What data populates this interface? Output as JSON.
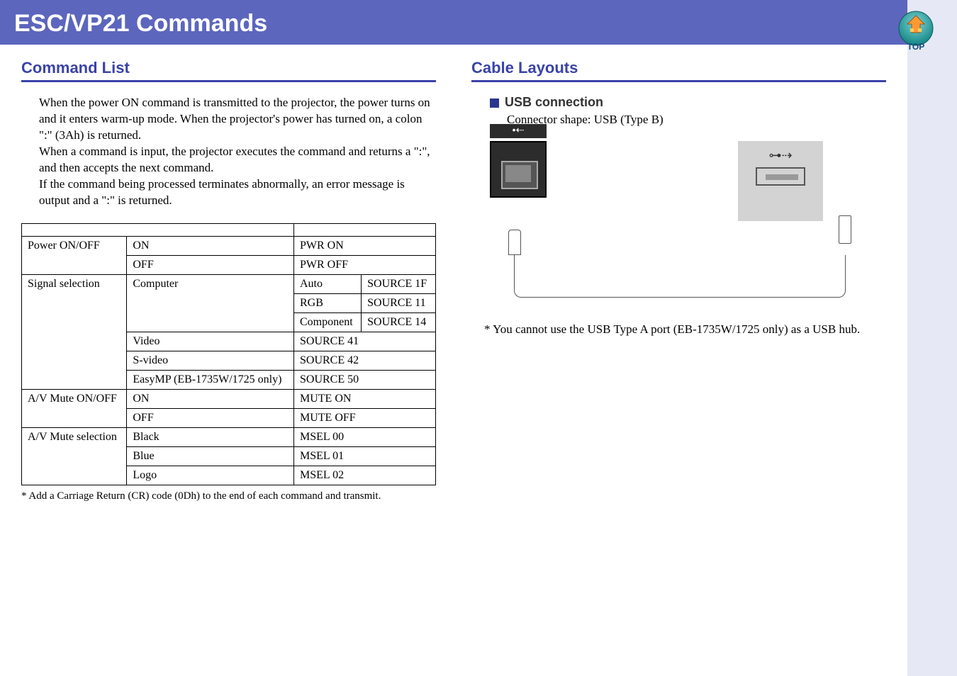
{
  "header": {
    "title": "ESC/VP21 Commands"
  },
  "left": {
    "title": "Command List",
    "intro": "When the power ON command is transmitted to the projector, the power turns on and it enters warm-up mode. When the projector's power has turned on, a colon \":\" (3Ah) is returned.\nWhen a command is input, the projector executes the command and returns a \":\", and then accepts the next command.\nIf the command being processed terminates abnormally, an error message is output and a \":\" is returned.",
    "table": {
      "rows": [
        {
          "item": "Power ON/OFF",
          "sub": "ON",
          "cmd": "PWR ON"
        },
        {
          "item": "",
          "sub": "OFF",
          "cmd": "PWR OFF"
        },
        {
          "item": "Signal selection",
          "sub": "Computer",
          "mode": "Auto",
          "cmd": "SOURCE 1F"
        },
        {
          "item": "",
          "sub": "",
          "mode": "RGB",
          "cmd": "SOURCE 11"
        },
        {
          "item": "",
          "sub": "",
          "mode": "Component",
          "cmd": "SOURCE 14"
        },
        {
          "item": "",
          "sub": "Video",
          "cmd": "SOURCE 41"
        },
        {
          "item": "",
          "sub": "S-video",
          "cmd": "SOURCE 42"
        },
        {
          "item": "",
          "sub": "EasyMP (EB-1735W/1725 only)",
          "cmd": "SOURCE 50"
        },
        {
          "item": "A/V Mute ON/OFF",
          "sub": "ON",
          "cmd": "MUTE ON"
        },
        {
          "item": "",
          "sub": "OFF",
          "cmd": "MUTE OFF"
        },
        {
          "item": "A/V Mute selection",
          "sub": "Black",
          "cmd": "MSEL 00"
        },
        {
          "item": "",
          "sub": "Blue",
          "cmd": "MSEL 01"
        },
        {
          "item": "",
          "sub": "Logo",
          "cmd": "MSEL 02"
        }
      ]
    },
    "footnote": "*  Add a Carriage Return (CR) code (0Dh) to the end of each command and transmit."
  },
  "right": {
    "title": "Cable Layouts",
    "subheading": "USB connection",
    "connector_desc": "Connector shape: USB (Type B)",
    "note": "* You cannot use the USB Type A port (EB-1735W/1725 only) as a USB hub."
  },
  "top_label": "TOP"
}
